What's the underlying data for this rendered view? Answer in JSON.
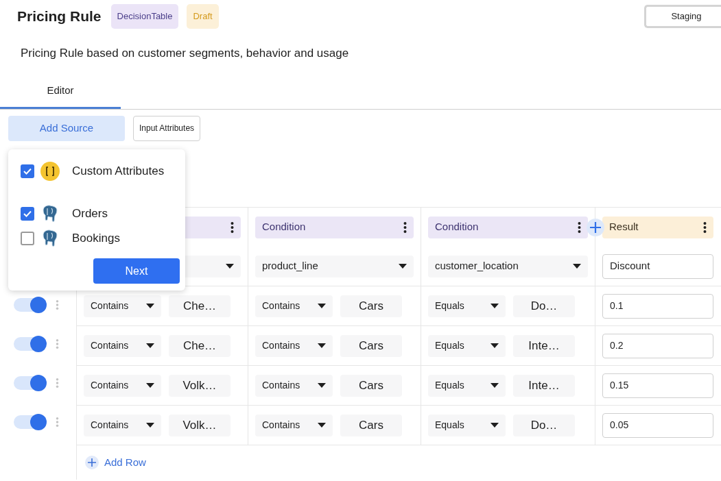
{
  "header": {
    "title": "Pricing Rule",
    "badges": [
      {
        "label": "DecisionTable",
        "kind": "type"
      },
      {
        "label": "Draft",
        "kind": "status"
      }
    ],
    "environment_button": "Staging"
  },
  "description": "Pricing Rule based on customer segments, behavior and usage",
  "tabs": [
    {
      "label": "Editor",
      "selected": true
    }
  ],
  "toolbar": {
    "buttons": [
      {
        "label": "Add Source",
        "kind": "primary"
      },
      {
        "label": "Input Attributes",
        "kind": "outline"
      }
    ]
  },
  "source_menu": {
    "items": [
      {
        "label": "Custom Attributes",
        "kind": "custom",
        "checked": true
      },
      {
        "label": "Orders",
        "kind": "database",
        "checked": true
      },
      {
        "label": "Bookings",
        "kind": "database",
        "checked": false
      }
    ],
    "next_button": "Next"
  },
  "table": {
    "columns": [
      {
        "kind": "condition"
      },
      {
        "kind": "condition",
        "label": "Condition",
        "attribute": "product_line"
      },
      {
        "kind": "condition",
        "label": "Condition",
        "attribute": "customer_location"
      },
      {
        "kind": "result",
        "label": "Result",
        "attribute": "Discount"
      }
    ],
    "rows": [
      {
        "enabled": true,
        "cells": [
          {
            "operator": "Contains",
            "value": "Che…"
          },
          {
            "operator": "Contains",
            "value": "Cars"
          },
          {
            "operator": "Equals",
            "value": "Do…"
          }
        ],
        "result": "0.1"
      },
      {
        "enabled": true,
        "cells": [
          {
            "operator": "Contains",
            "value": "Che…"
          },
          {
            "operator": "Contains",
            "value": "Cars"
          },
          {
            "operator": "Equals",
            "value": "Inte…"
          }
        ],
        "result": "0.2"
      },
      {
        "enabled": true,
        "cells": [
          {
            "operator": "Contains",
            "value": "Volk…"
          },
          {
            "operator": "Contains",
            "value": "Cars"
          },
          {
            "operator": "Equals",
            "value": "Inte…"
          }
        ],
        "result": "0.15"
      },
      {
        "enabled": true,
        "cells": [
          {
            "operator": "Contains",
            "value": "Volk…"
          },
          {
            "operator": "Contains",
            "value": "Cars"
          },
          {
            "operator": "Equals",
            "value": "Do…"
          }
        ],
        "result": "0.05"
      }
    ],
    "add_row": "Add Row"
  }
}
